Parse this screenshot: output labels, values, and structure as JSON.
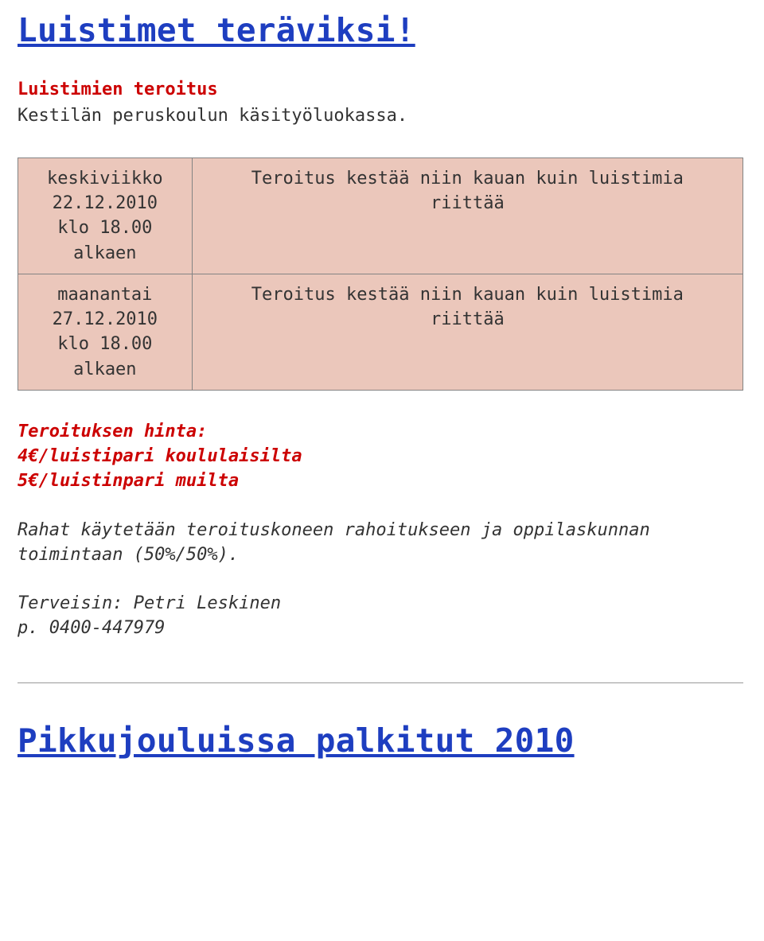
{
  "title": "Luistimet teräviksi!",
  "subtitle": "Luistimien teroitus",
  "description": "Kestilän peruskoulun käsityöluokassa.",
  "schedule": [
    {
      "day": "keskiviikko",
      "date": "22.12.2010",
      "time": "klo 18.00",
      "state": "alkaen",
      "note_line1": "Teroitus kestää niin kauan kuin luistimia",
      "note_line2": "riittää"
    },
    {
      "day": "maanantai",
      "date": "27.12.2010",
      "time": "klo 18.00",
      "state": "alkaen",
      "note_line1": "Teroitus kestää niin kauan kuin luistimia",
      "note_line2": "riittää"
    }
  ],
  "price": {
    "title": "Teroituksen hinta:",
    "line1": "4€/luistipari koululaisilta",
    "line2": "5€/luistinpari muilta"
  },
  "use_text": "Rahat käytetään teroituskoneen rahoitukseen ja oppilaskunnan toimintaan (50%/50%).",
  "sign": {
    "greeting": "Terveisin: Petri Leskinen",
    "phone": "p. 0400-447979"
  },
  "footer_title": "Pikkujouluissa palkitut 2010"
}
